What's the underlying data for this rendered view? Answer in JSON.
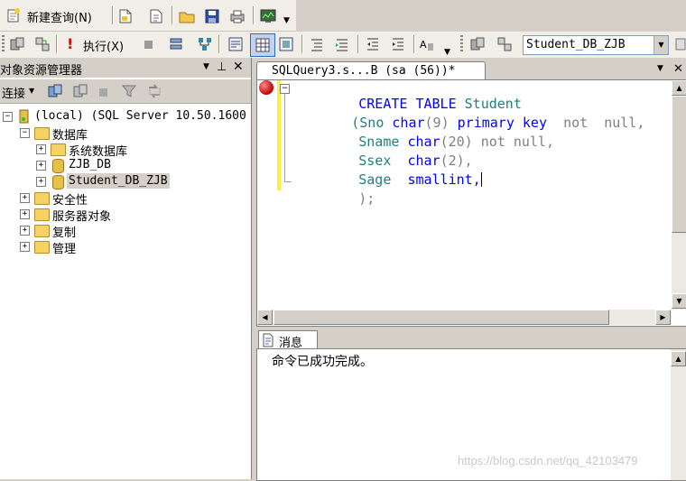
{
  "toolbar1": {
    "new_query_label": "新建查询(N)"
  },
  "toolbar2": {
    "execute_label": "执行(X)",
    "database_select": "Student_DB_ZJB"
  },
  "object_explorer": {
    "title": "对象资源管理器",
    "pin_glyph": "▾ ⊥ ✕",
    "connect_label": "连接",
    "server_node": "(local) (SQL Server 10.50.1600",
    "databases_node": "数据库",
    "system_db_node": "系统数据库",
    "db1_node": "ZJB_DB",
    "db2_node": "Student_DB_ZJB",
    "security_node": "安全性",
    "server_objects_node": "服务器对象",
    "replication_node": "复制",
    "management_node": "管理"
  },
  "editor": {
    "tab_title": "SQLQuery3.s...B (sa (56))*",
    "lines": {
      "l1_kw": "CREATE TABLE",
      "l1_name": "Student",
      "l2_a": "(Sno",
      "l2_type": "char",
      "l2_size": "(9)",
      "l2_kw": "primary key",
      "l2_rest": "not  null,",
      "l3_a": "Sname",
      "l3_type": "char",
      "l3_size": "(20)",
      "l3_rest": "not null,",
      "l4_a": "Ssex",
      "l4_type": "char",
      "l4_size": "(2),",
      "l5_a": "Sage",
      "l5_type": "smallint,",
      "l6": ");"
    }
  },
  "messages": {
    "tab_label": "消息",
    "text": "命令已成功完成。"
  },
  "watermark": "https://blog.csdn.net/qq_42103479",
  "colors": {
    "keyword": "#0000ff",
    "identifier": "#1f7f7f",
    "gray": "#808080",
    "background": "#d4d0c8"
  }
}
